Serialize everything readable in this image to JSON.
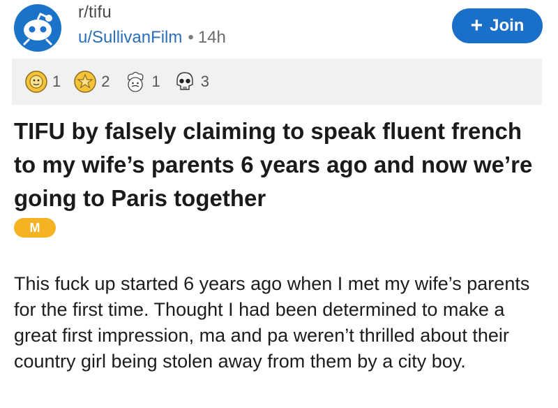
{
  "header": {
    "subreddit": "r/tifu",
    "author": "u/SullivanFilm",
    "separator": "•",
    "age": "14h",
    "join_label": "Join",
    "join_icon": "plus-icon"
  },
  "colors": {
    "accent": "#1a6fc9",
    "flair": "#f5b324",
    "award_bar": "#f1f1f1"
  },
  "awards": [
    {
      "icon": "sun-face-award-icon",
      "count": "1"
    },
    {
      "icon": "gold-star-award-icon",
      "count": "2"
    },
    {
      "icon": "chef-face-award-icon",
      "count": "1"
    },
    {
      "icon": "skull-award-icon",
      "count": "3"
    }
  ],
  "post": {
    "title": "TIFU by falsely claiming to speak fluent french to my wife’s parents 6 years ago and now we’re going to Paris together",
    "flair": "M",
    "body": "This fuck up started 6 years ago when I met my wife’s parents for the first time. Thought I had been determined to make a great first impression, ma and pa weren’t thrilled about their country girl being stolen away from them by a city boy."
  }
}
